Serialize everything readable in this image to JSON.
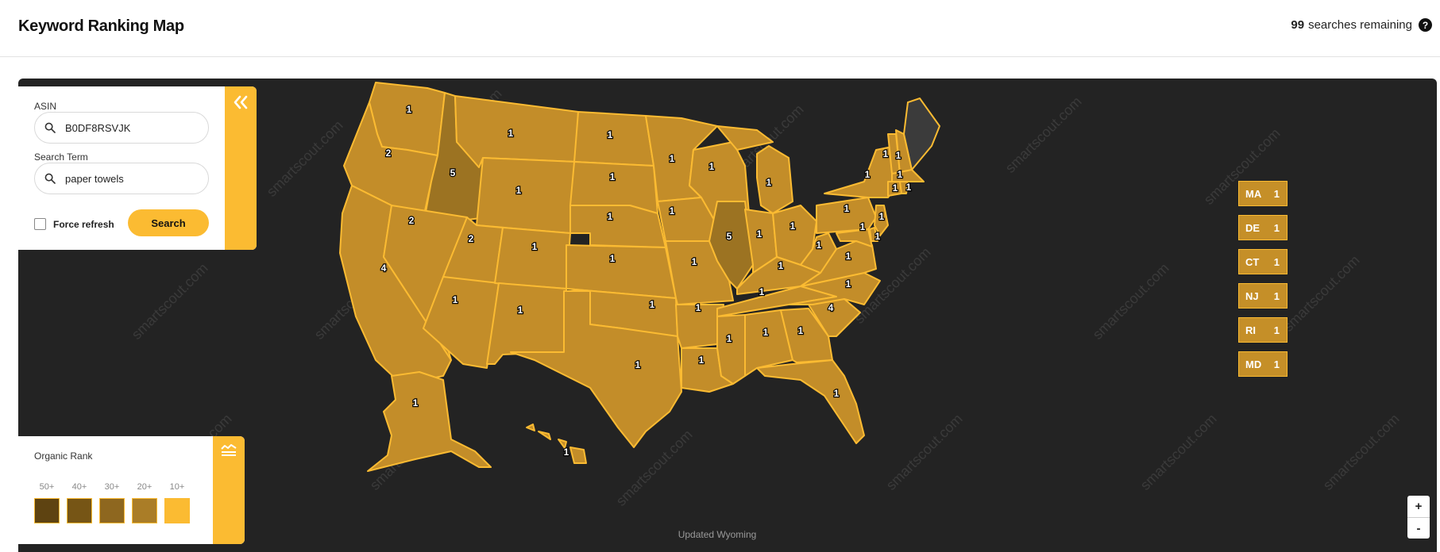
{
  "header": {
    "title": "Keyword Ranking Map",
    "searches_count": "99",
    "searches_label": "searches remaining"
  },
  "search_panel": {
    "asin_label": "ASIN",
    "asin_value": "B0DF8RSVJK",
    "term_label": "Search Term",
    "term_value": "paper towels",
    "force_refresh_label": "Force refresh",
    "force_refresh_checked": false,
    "search_button": "Search"
  },
  "legend": {
    "title": "Organic Rank",
    "items": [
      {
        "label": "50+",
        "color": "#5e4311"
      },
      {
        "label": "40+",
        "color": "#765515"
      },
      {
        "label": "30+",
        "color": "#8e671f"
      },
      {
        "label": "20+",
        "color": "#aa7d27"
      },
      {
        "label": "10+",
        "color": "#fbbb32"
      }
    ]
  },
  "colors": {
    "accent": "#fbbb32",
    "map_background": "#232323",
    "state_fill_rank_1": "#c38d29",
    "state_fill_darker": "#9c7322",
    "state_no_data": "#3b3b3b"
  },
  "state_badges": [
    {
      "state": "MA",
      "value": "1"
    },
    {
      "state": "DE",
      "value": "1"
    },
    {
      "state": "CT",
      "value": "1"
    },
    {
      "state": "NJ",
      "value": "1"
    },
    {
      "state": "RI",
      "value": "1"
    },
    {
      "state": "MD",
      "value": "1"
    }
  ],
  "state_ranks": [
    {
      "state": "WA",
      "value": "1"
    },
    {
      "state": "OR",
      "value": "2"
    },
    {
      "state": "CA",
      "value": "4"
    },
    {
      "state": "ID",
      "value": "5"
    },
    {
      "state": "NV",
      "value": "2"
    },
    {
      "state": "MT",
      "value": "1"
    },
    {
      "state": "WY",
      "value": "1"
    },
    {
      "state": "UT",
      "value": "2"
    },
    {
      "state": "AZ",
      "value": "1"
    },
    {
      "state": "CO",
      "value": "1"
    },
    {
      "state": "NM",
      "value": "1"
    },
    {
      "state": "ND",
      "value": "1"
    },
    {
      "state": "SD",
      "value": "1"
    },
    {
      "state": "NE",
      "value": "1"
    },
    {
      "state": "KS",
      "value": "1"
    },
    {
      "state": "OK",
      "value": "1"
    },
    {
      "state": "TX",
      "value": "1"
    },
    {
      "state": "MN",
      "value": "1"
    },
    {
      "state": "IA",
      "value": "1"
    },
    {
      "state": "MO",
      "value": "1"
    },
    {
      "state": "AR",
      "value": "1"
    },
    {
      "state": "LA",
      "value": "1"
    },
    {
      "state": "WI",
      "value": "1"
    },
    {
      "state": "IL",
      "value": "5"
    },
    {
      "state": "MI",
      "value": "1"
    },
    {
      "state": "IN",
      "value": "1"
    },
    {
      "state": "OH",
      "value": "1"
    },
    {
      "state": "KY",
      "value": "1"
    },
    {
      "state": "TN",
      "value": "1"
    },
    {
      "state": "MS",
      "value": "1"
    },
    {
      "state": "AL",
      "value": "1"
    },
    {
      "state": "GA",
      "value": "1"
    },
    {
      "state": "FL",
      "value": "1"
    },
    {
      "state": "SC",
      "value": "4"
    },
    {
      "state": "NC",
      "value": "1"
    },
    {
      "state": "VA",
      "value": "1"
    },
    {
      "state": "WV",
      "value": "1"
    },
    {
      "state": "PA",
      "value": "1"
    },
    {
      "state": "NY",
      "value": "1"
    },
    {
      "state": "VT",
      "value": "1"
    },
    {
      "state": "NH",
      "value": "1"
    },
    {
      "state": "MA",
      "value": "1"
    },
    {
      "state": "CT",
      "value": "1"
    },
    {
      "state": "RI",
      "value": "1"
    },
    {
      "state": "NJ",
      "value": "1"
    },
    {
      "state": "DE",
      "value": "1"
    },
    {
      "state": "MD",
      "value": "1"
    },
    {
      "state": "AK",
      "value": "1"
    },
    {
      "state": "HI",
      "value": "1"
    }
  ],
  "footer": {
    "status": "Updated Wyoming"
  },
  "zoom": {
    "in": "+",
    "out": "-"
  },
  "watermark": "smartscout.com"
}
